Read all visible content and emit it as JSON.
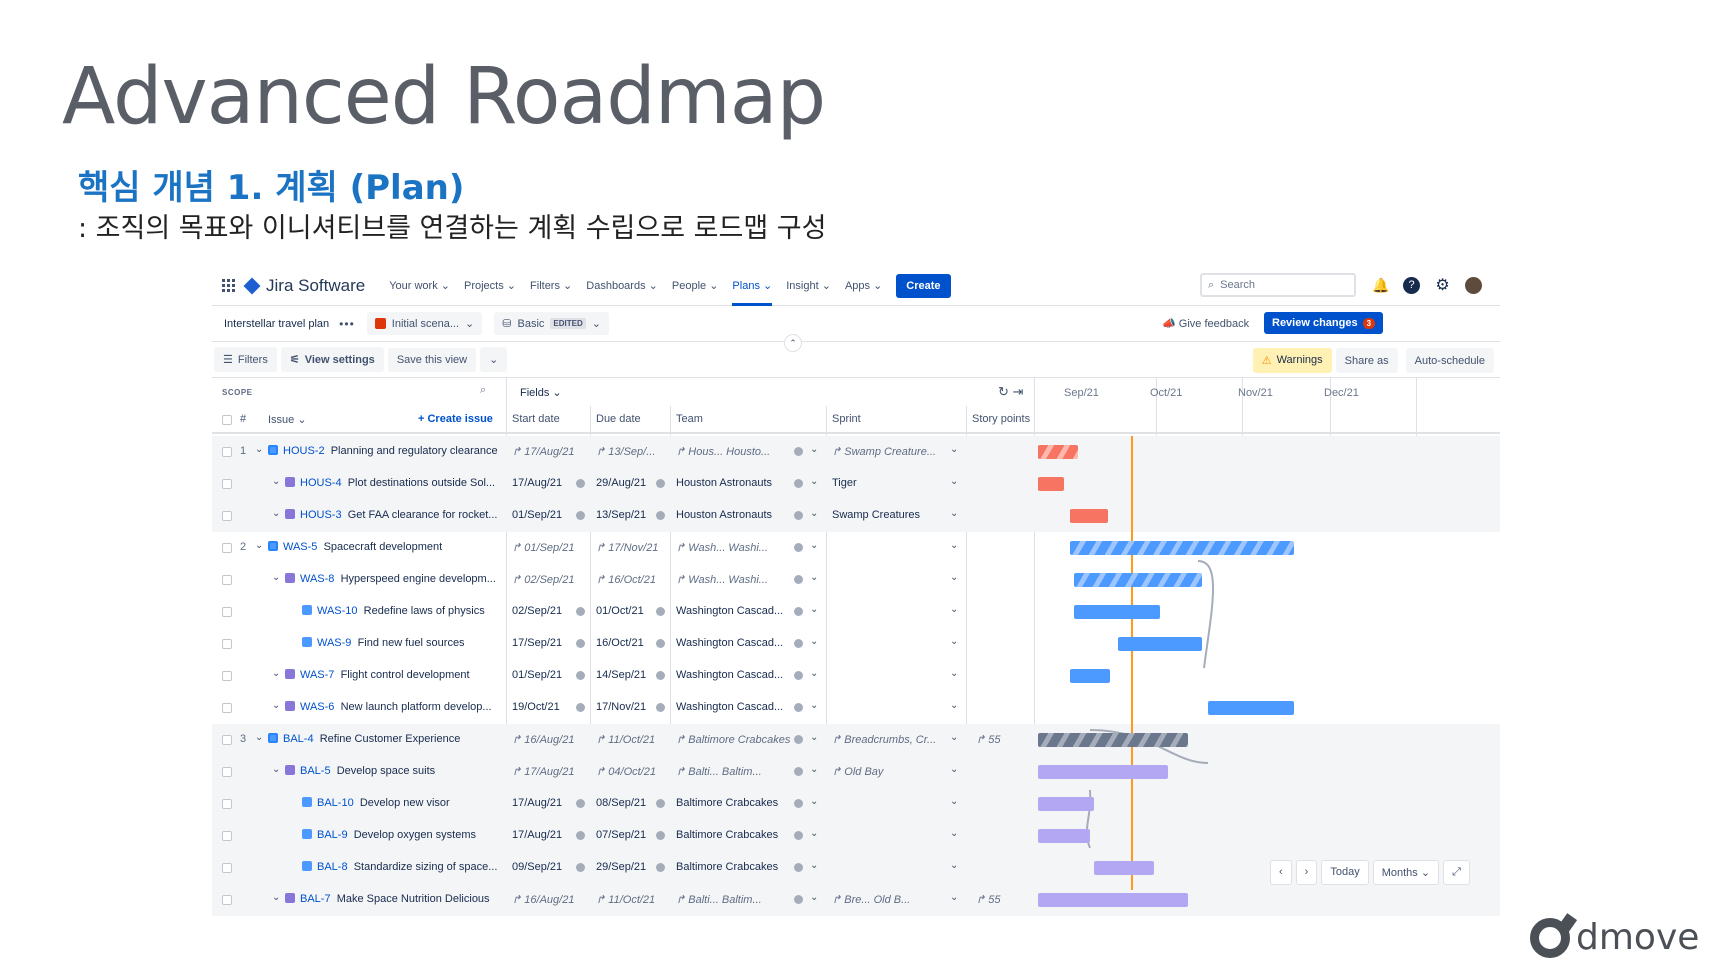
{
  "slide": {
    "title": "Advanced Roadmap",
    "subtitle": "핵심 개념 1. 계획 (Plan)",
    "description": ": 조직의 목표와 이니셔티브를 연결하는 계획 수립으로 로드맵 구성",
    "brand": "dmove"
  },
  "nav": {
    "product": "Jira Software",
    "items": [
      "Your work",
      "Projects",
      "Filters",
      "Dashboards",
      "People",
      "Plans",
      "Insight",
      "Apps"
    ],
    "active": "Plans",
    "create": "Create",
    "search_placeholder": "Search"
  },
  "planbar": {
    "plan_name": "Interstellar travel plan",
    "scenario": "Initial scena...",
    "view": "Basic",
    "view_badge": "EDITED",
    "feedback": "Give feedback",
    "review": "Review changes",
    "review_count": "3"
  },
  "toolbar": {
    "filters": "Filters",
    "view_settings": "View settings",
    "save_view": "Save this view",
    "warnings": "Warnings",
    "share": "Share as",
    "auto": "Auto-schedule"
  },
  "columns": {
    "scope": "SCOPE",
    "fields": "Fields",
    "hash": "#",
    "issue": "Issue",
    "create_issue": "+ Create issue",
    "start": "Start date",
    "due": "Due date",
    "team": "Team",
    "sprint": "Sprint",
    "points": "Story points",
    "months": [
      "Sep/21",
      "Oct/21",
      "Nov/21",
      "Dec/21"
    ]
  },
  "rows": [
    {
      "num": "1",
      "key": "HOUS-2",
      "title": "Planning and regulatory clearance",
      "start": "17/Aug/21",
      "due": "13/Sep/...",
      "team": "Hous...   Housto...",
      "sprint": "Swamp Creature...",
      "points": ""
    },
    {
      "num": "",
      "key": "HOUS-4",
      "title": "Plot destinations outside Sol...",
      "start": "17/Aug/21",
      "due": "29/Aug/21",
      "team": "Houston Astronauts",
      "sprint": "Tiger",
      "points": ""
    },
    {
      "num": "",
      "key": "HOUS-3",
      "title": "Get FAA clearance for rocket...",
      "start": "01/Sep/21",
      "due": "13/Sep/21",
      "team": "Houston Astronauts",
      "sprint": "Swamp Creatures",
      "points": ""
    },
    {
      "num": "2",
      "key": "WAS-5",
      "title": "Spacecraft development",
      "start": "01/Sep/21",
      "due": "17/Nov/21",
      "team": "Wash...   Washi...",
      "sprint": "",
      "points": ""
    },
    {
      "num": "",
      "key": "WAS-8",
      "title": "Hyperspeed engine developm...",
      "start": "02/Sep/21",
      "due": "16/Oct/21",
      "team": "Wash...   Washi...",
      "sprint": "",
      "points": ""
    },
    {
      "num": "",
      "key": "WAS-10",
      "title": "Redefine laws of physics",
      "start": "02/Sep/21",
      "due": "01/Oct/21",
      "team": "Washington Cascad...",
      "sprint": "",
      "points": ""
    },
    {
      "num": "",
      "key": "WAS-9",
      "title": "Find new fuel sources",
      "start": "17/Sep/21",
      "due": "16/Oct/21",
      "team": "Washington Cascad...",
      "sprint": "",
      "points": ""
    },
    {
      "num": "",
      "key": "WAS-7",
      "title": "Flight control development",
      "start": "01/Sep/21",
      "due": "14/Sep/21",
      "team": "Washington Cascad...",
      "sprint": "",
      "points": ""
    },
    {
      "num": "",
      "key": "WAS-6",
      "title": "New launch platform develop...",
      "start": "19/Oct/21",
      "due": "17/Nov/21",
      "team": "Washington Cascad...",
      "sprint": "",
      "points": ""
    },
    {
      "num": "3",
      "key": "BAL-4",
      "title": "Refine Customer Experience",
      "start": "16/Aug/21",
      "due": "11/Oct/21",
      "team": "Baltimore Crabcakes",
      "sprint": "Breadcrumbs, Cr...",
      "points": "55"
    },
    {
      "num": "",
      "key": "BAL-5",
      "title": "Develop space suits",
      "start": "17/Aug/21",
      "due": "04/Oct/21",
      "team": "Balti...   Baltim...",
      "sprint": "Old Bay",
      "points": ""
    },
    {
      "num": "",
      "key": "BAL-10",
      "title": "Develop new visor",
      "start": "17/Aug/21",
      "due": "08/Sep/21",
      "team": "Baltimore Crabcakes",
      "sprint": "",
      "points": ""
    },
    {
      "num": "",
      "key": "BAL-9",
      "title": "Develop oxygen systems",
      "start": "17/Aug/21",
      "due": "07/Sep/21",
      "team": "Baltimore Crabcakes",
      "sprint": "",
      "points": ""
    },
    {
      "num": "",
      "key": "BAL-8",
      "title": "Standardize sizing of space...",
      "start": "09/Sep/21",
      "due": "29/Sep/21",
      "team": "Baltimore Crabcakes",
      "sprint": "",
      "points": ""
    },
    {
      "num": "",
      "key": "BAL-7",
      "title": "Make Space Nutrition Delicious",
      "start": "16/Aug/21",
      "due": "11/Oct/21",
      "team": "Balti...   Baltim...",
      "sprint": "Bre...   Old B...",
      "points": "55"
    }
  ],
  "timeline_controls": {
    "today": "Today",
    "months": "Months"
  }
}
